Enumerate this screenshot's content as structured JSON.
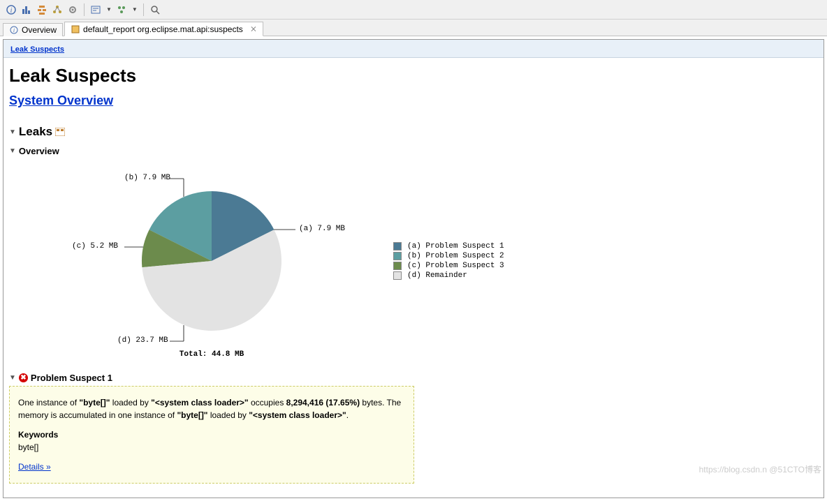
{
  "tabs": {
    "overview": "Overview",
    "report": "default_report  org.eclipse.mat.api:suspects"
  },
  "breadcrumb": "Leak Suspects",
  "page_title": "Leak Suspects",
  "system_overview_link": "System Overview",
  "sections": {
    "leaks": "Leaks",
    "overview": "Overview",
    "problem1": "Problem Suspect 1"
  },
  "chart_data": {
    "type": "pie",
    "title": "",
    "total_label": "Total: 44.8 MB",
    "series": [
      {
        "key": "a",
        "name": "Problem Suspect 1",
        "value_mb": 7.9,
        "label": "(a)  7.9 MB",
        "color": "#4b7a94"
      },
      {
        "key": "b",
        "name": "Problem Suspect 2",
        "value_mb": 7.9,
        "label": "(b)  7.9 MB",
        "color": "#5c9ea1"
      },
      {
        "key": "c",
        "name": "Problem Suspect 3",
        "value_mb": 5.2,
        "label": "(c)  5.2 MB",
        "color": "#6c8b4c"
      },
      {
        "key": "d",
        "name": "Remainder",
        "value_mb": 23.7,
        "label": "(d)  23.7 MB",
        "color": "#e3e3e3"
      }
    ],
    "legend": [
      "(a)  Problem Suspect 1",
      "(b)  Problem Suspect 2",
      "(c)  Problem Suspect 3",
      "(d)  Remainder"
    ]
  },
  "problem_suspect_1": {
    "text_prefix": "One instance of ",
    "class1": "\"byte[]\"",
    "loaded_by": " loaded by ",
    "loader": "\"<system class loader>\"",
    "occupies": " occupies ",
    "size": "8,294,416 (17.65%)",
    "bytes_suffix": " bytes. The memory is accumulated in one instance of ",
    "class2": "\"byte[]\"",
    "loaded_by2": " loaded by ",
    "loader2": "\"<system class loader>\"",
    "period": ".",
    "keywords_head": "Keywords",
    "keywords_val": "byte[]",
    "details_link": "Details »"
  },
  "watermark": "https://blog.csdn.n @51CTO博客"
}
